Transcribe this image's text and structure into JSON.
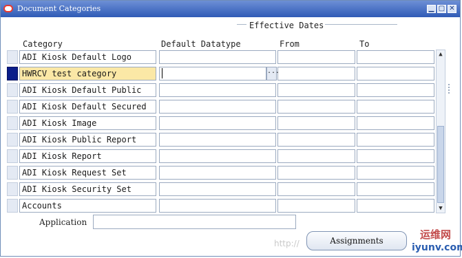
{
  "window": {
    "title": "Document Categories",
    "minimize": "▁",
    "maximize": "▢",
    "close": "✕"
  },
  "section": {
    "title": "Effective Dates"
  },
  "columns": {
    "category": "Category",
    "datatype": "Default Datatype",
    "from": "From",
    "to": "To"
  },
  "rows": [
    {
      "category": "ADI Kiosk Default Logo",
      "datatype": "",
      "from": "",
      "to": ""
    },
    {
      "category": "HWRCV test category",
      "datatype": "",
      "from": "",
      "to": ""
    },
    {
      "category": "ADI Kiosk Default Public",
      "datatype": "",
      "from": "",
      "to": ""
    },
    {
      "category": "ADI Kiosk Default Secured",
      "datatype": "",
      "from": "",
      "to": ""
    },
    {
      "category": "ADI Kiosk Image",
      "datatype": "",
      "from": "",
      "to": ""
    },
    {
      "category": "ADI Kiosk Public Report",
      "datatype": "",
      "from": "",
      "to": ""
    },
    {
      "category": "ADI Kiosk Report",
      "datatype": "",
      "from": "",
      "to": ""
    },
    {
      "category": "ADI Kiosk Request Set",
      "datatype": "",
      "from": "",
      "to": ""
    },
    {
      "category": "ADI Kiosk Security Set",
      "datatype": "",
      "from": "",
      "to": ""
    },
    {
      "category": "Accounts",
      "datatype": "",
      "from": "",
      "to": ""
    }
  ],
  "lov_button": "...",
  "footer": {
    "application_label": "Application",
    "application_value": "",
    "assignments_button": "Assignments"
  },
  "watermark": {
    "url": "http://",
    "logo_cn": "运维网",
    "logo_en": "iyunv.com"
  },
  "colors": {
    "titlebar": "#2f5bb6",
    "selected_row": "#fbe8a6",
    "row_indicator": "#0a1d8a"
  }
}
